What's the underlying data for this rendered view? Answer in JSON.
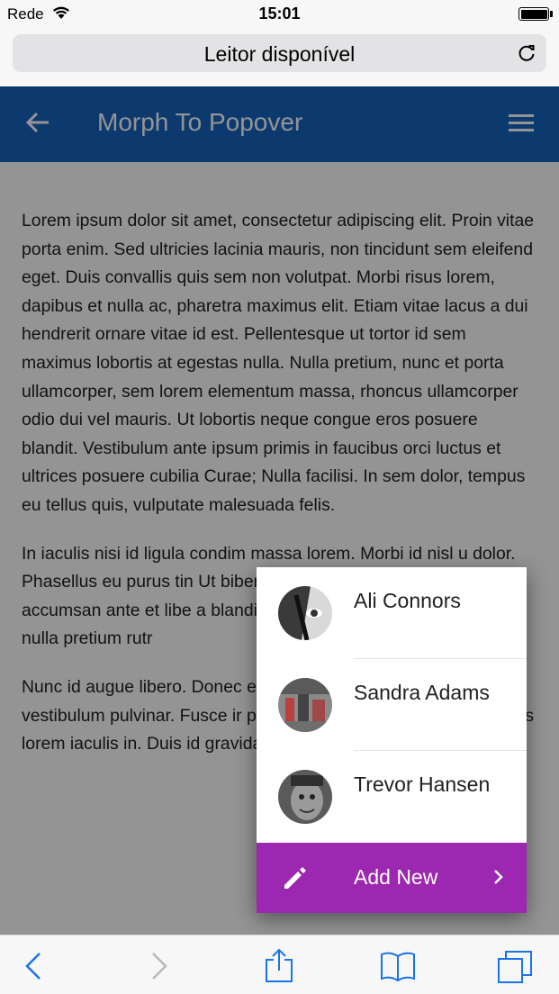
{
  "status_bar": {
    "carrier": "Rede",
    "time": "15:01"
  },
  "safari": {
    "address_text": "Leitor disponível"
  },
  "app_bar": {
    "title": "Morph To Popover",
    "color": "#1565c0"
  },
  "content": {
    "paragraphs": [
      "Lorem ipsum dolor sit amet, consectetur adipiscing elit. Proin vitae porta enim. Sed ultricies lacinia mauris, non tincidunt sem eleifend eget. Duis convallis quis sem non volutpat. Morbi risus lorem, dapibus et nulla ac, pharetra maximus elit. Etiam vitae lacus a dui hendrerit ornare vitae id est. Pellentesque ut tortor id sem maximus lobortis at egestas nulla. Nulla pretium, nunc et porta ullamcorper, sem lorem elementum massa, rhoncus ullamcorper odio dui vel mauris. Ut lobortis neque congue eros posuere blandit. Vestibulum ante ipsum primis in faucibus orci luctus et ultrices posuere cubilia Curae; Nulla facilisi. In sem dolor, tempus eu tellus quis, vulputate malesuada felis.",
      "In iaculis nisi id ligula condim massa lorem. Morbi id nisl u dolor. Phasellus eu purus tin Ut bibendum tincidunt nisi, s Fusce accumsan ante et libe a blandit. Nunc a est eu urna a ipsum sed nulla pretium rutr",
      "Nunc id augue libero. Donec e vulputate purus, a semper ju vestibulum pulvinar. Fusce ir pellentesque ac sit amet ser faucibus lorem iaculis in. Duis id gravida libero."
    ]
  },
  "popover": {
    "people": [
      {
        "name": "Ali Connors"
      },
      {
        "name": "Sandra Adams"
      },
      {
        "name": "Trevor Hansen"
      }
    ],
    "add_label": "Add New",
    "add_color": "#9c27b0"
  },
  "icons": {
    "back": "arrow-left-icon",
    "menu": "hamburger-menu-icon",
    "reload": "reload-icon",
    "pencil": "pencil-icon",
    "chevron": "chevron-right-icon",
    "toolbar": [
      "safari-back-icon",
      "safari-forward-icon",
      "share-icon",
      "bookmarks-icon",
      "tabs-icon"
    ]
  }
}
